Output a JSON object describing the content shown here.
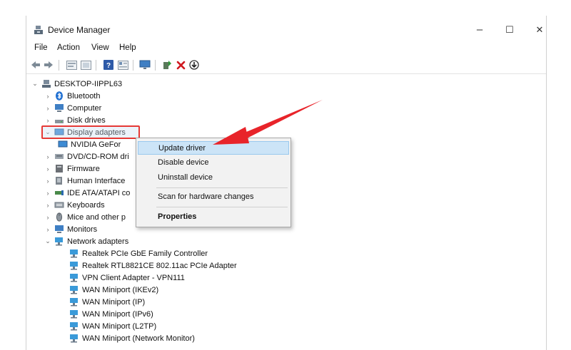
{
  "window": {
    "title": "Device Manager",
    "controls": {
      "minimize": "–",
      "maximize": "☐",
      "close": "✕"
    }
  },
  "menu": [
    "File",
    "Action",
    "View",
    "Help"
  ],
  "toolbar": [
    "back-icon",
    "forward-icon",
    "properties-icon",
    "list-icon",
    "help-icon",
    "view-icon",
    "monitor-icon",
    "add-driver-icon",
    "uninstall-icon",
    "download-icon"
  ],
  "tree": {
    "root": "DESKTOP-IIPPL63",
    "categories": [
      {
        "label": "Bluetooth",
        "icon": "bluetooth-icon"
      },
      {
        "label": "Computer",
        "icon": "computer-icon"
      },
      {
        "label": "Disk drives",
        "icon": "disk-icon"
      },
      {
        "label": "Display adapters",
        "icon": "display-adapter-icon",
        "child": "NVIDIA GeFor"
      },
      {
        "label": "DVD/CD-ROM dri",
        "icon": "dvd-icon"
      },
      {
        "label": "Firmware",
        "icon": "firmware-icon"
      },
      {
        "label": "Human Interface",
        "icon": "hid-icon"
      },
      {
        "label": "IDE ATA/ATAPI co",
        "icon": "ide-icon"
      },
      {
        "label": "Keyboards",
        "icon": "keyboard-icon"
      },
      {
        "label": "Mice and other p",
        "icon": "mouse-icon"
      },
      {
        "label": "Monitors",
        "icon": "monitor-icon"
      },
      {
        "label": "Network adapters",
        "icon": "network-icon"
      }
    ],
    "network_children": [
      "Realtek PCIe GbE Family Controller",
      "Realtek RTL8821CE 802.11ac PCIe Adapter",
      "VPN Client Adapter - VPN111",
      "WAN Miniport (IKEv2)",
      "WAN Miniport (IP)",
      "WAN Miniport (IPv6)",
      "WAN Miniport (L2TP)",
      "WAN Miniport (Network Monitor)"
    ]
  },
  "context_menu": {
    "update": "Update driver",
    "disable": "Disable device",
    "uninstall": "Uninstall device",
    "scan": "Scan for hardware changes",
    "properties": "Properties"
  },
  "colors": {
    "highlight_border": "#e53935",
    "arrow": "#e8242a",
    "selection": "#cce4f7"
  }
}
